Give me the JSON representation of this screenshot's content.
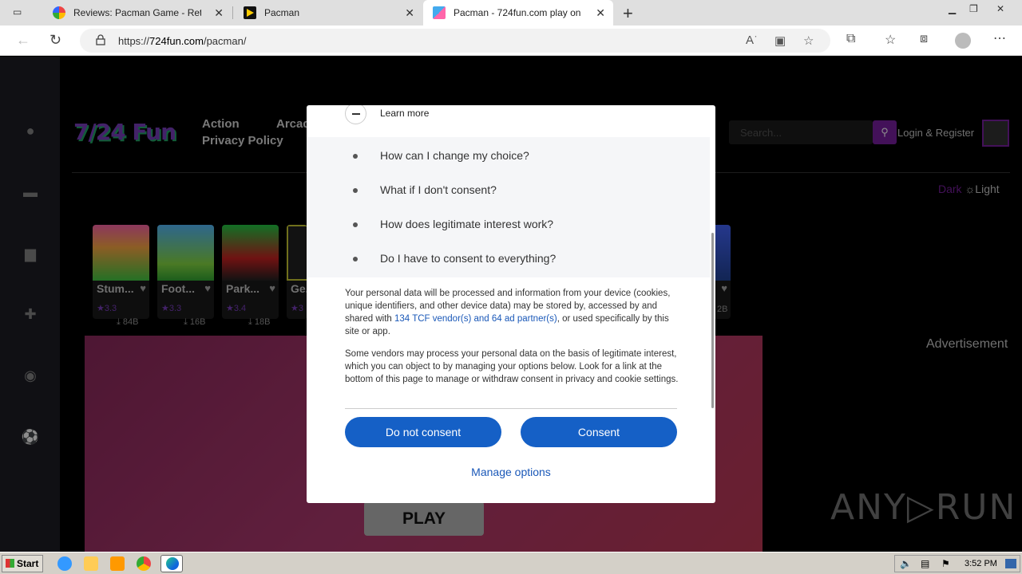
{
  "browser": {
    "tabs": [
      {
        "label": "Reviews: Pacman Game - Retro",
        "close": "✕"
      },
      {
        "label": "Pacman",
        "close": "✕"
      },
      {
        "label": "Pacman - 724fun.com play onli",
        "close": "✕"
      }
    ],
    "new_tab": "+",
    "url_prefix": "https://",
    "url_host": "724fun.com",
    "url_path": "/pacman/"
  },
  "site": {
    "logo": "7/24 Fun",
    "nav": [
      "Action",
      "Arcade",
      "Privacy Policy"
    ],
    "search_placeholder": "Search...",
    "login": "Login & Register",
    "theme_dark": "Dark",
    "theme_light": "Light",
    "advertisement": "Advertisement",
    "play": "PLAY",
    "watermark": "ANY▷RUN",
    "games": [
      {
        "name": "Stum...",
        "rating": "★3.3",
        "downloads": "84B"
      },
      {
        "name": "Foot...",
        "rating": "★3.3",
        "downloads": "16B"
      },
      {
        "name": "Park...",
        "rating": "★3.4",
        "downloads": "18B"
      },
      {
        "name": "Ge...",
        "rating": "★3",
        "downloads": ""
      }
    ],
    "partial_right_downloads": "2B"
  },
  "consent": {
    "learn_more": "Learn more",
    "faq": [
      "How can I change my choice?",
      "What if I don't consent?",
      "How does legitimate interest work?",
      "Do I have to consent to everything?"
    ],
    "para1_a": "Your personal data will be processed and information from your device (cookies, unique identifiers, and other device data) may be stored by, accessed by and shared with ",
    "para1_link": "134 TCF vendor(s) and 64 ad partner(s)",
    "para1_b": ", or used specifically by this site or app.",
    "para2": "Some vendors may process your personal data on the basis of legitimate interest, which you can object to by managing your options below. Look for a link at the bottom of this page to manage or withdraw consent in privacy and cookie settings.",
    "do_not_consent": "Do not consent",
    "consent": "Consent",
    "manage_options": "Manage options"
  },
  "taskbar": {
    "start": "Start",
    "clock": "3:52 PM"
  },
  "colors": {
    "accent": "#7b1fa2",
    "consent_blue": "#1560c6"
  }
}
